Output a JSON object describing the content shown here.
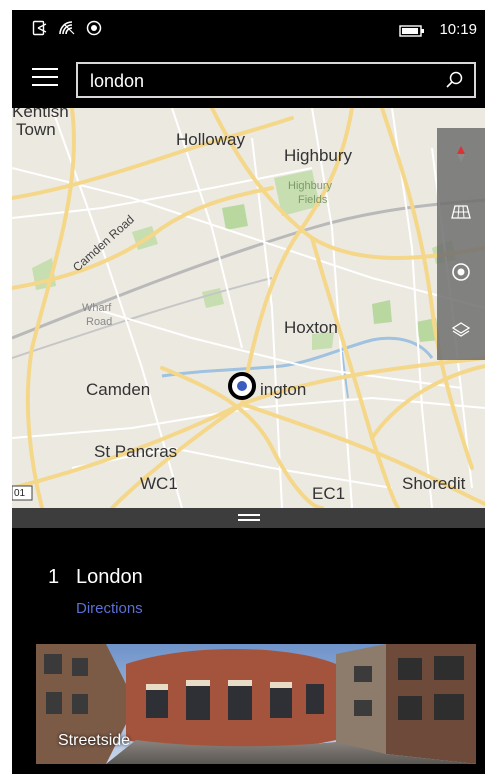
{
  "status_bar": {
    "time": "10:19",
    "icons": [
      "nfc-icon",
      "wifi-signal-icon",
      "location-status-icon",
      "battery-icon"
    ]
  },
  "search": {
    "value": "london"
  },
  "map": {
    "labels": {
      "kentish": "Kentish",
      "town": "Town",
      "holloway": "Holloway",
      "highbury": "Highbury",
      "highbury_fields_1": "Highbury",
      "highbury_fields_2": "Fields",
      "camden_road": "Camden Road",
      "wharf_1": "Wharf",
      "wharf_2": "Road",
      "hoxton": "Hoxton",
      "camden": "Camden",
      "islington": "ington",
      "st_pancras": "St Pancras",
      "wc1": "WC1",
      "ec1": "EC1",
      "shoreditch": "Shoredit",
      "route_marker": "01"
    },
    "controls": [
      "compass-icon",
      "3d-buildings-icon",
      "my-location-icon",
      "layers-icon"
    ]
  },
  "result": {
    "index": "1",
    "title": "London",
    "directions_label": "Directions",
    "streetside_label": "Streetside"
  },
  "colors": {
    "accent": "#5b6fd6",
    "map_background": "#ece9e1",
    "road": "#f5d78a",
    "park": "#b9d8a0"
  }
}
